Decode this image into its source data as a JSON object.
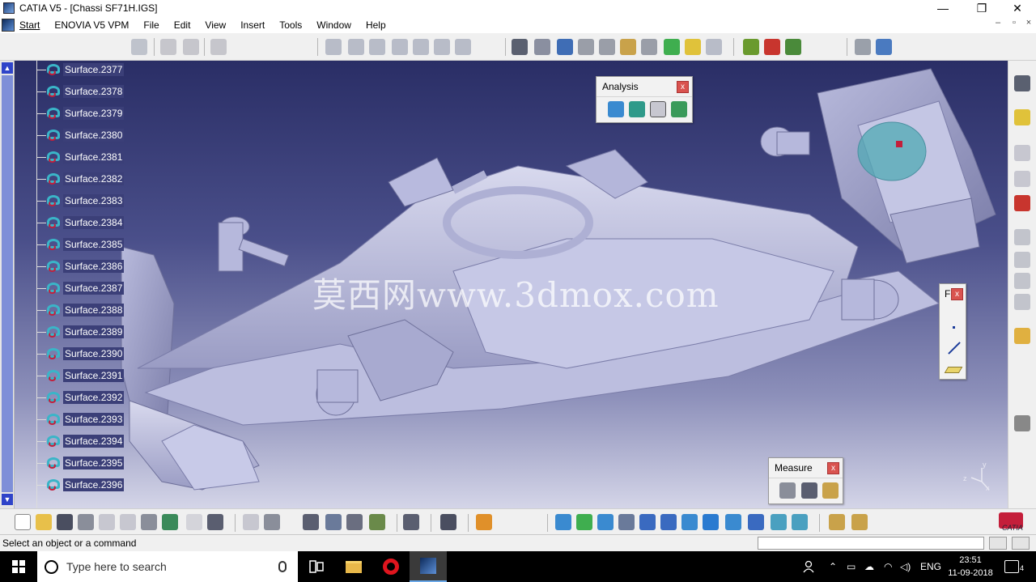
{
  "window": {
    "title": "CATIA V5 - [Chassi SF71H.IGS]",
    "minimize": "—",
    "maximize": "❐",
    "close": "✕"
  },
  "menu": {
    "items": [
      "Start",
      "ENOVIA V5 VPM",
      "File",
      "Edit",
      "View",
      "Insert",
      "Tools",
      "Window",
      "Help"
    ],
    "doc_controls": [
      "–",
      "▫",
      "×"
    ]
  },
  "tree": {
    "items": [
      "Surface.2377",
      "Surface.2378",
      "Surface.2379",
      "Surface.2380",
      "Surface.2381",
      "Surface.2382",
      "Surface.2383",
      "Surface.2384",
      "Surface.2385",
      "Surface.2386",
      "Surface.2387",
      "Surface.2388",
      "Surface.2389",
      "Surface.2390",
      "Surface.2391",
      "Surface.2392",
      "Surface.2393",
      "Surface.2394",
      "Surface.2395",
      "Surface.2396"
    ]
  },
  "viewport": {
    "watermark": "莫西网www.3dmox.com",
    "axis_labels": [
      "y",
      "z",
      "x"
    ]
  },
  "analysis_palette": {
    "title": "Analysis",
    "close": "x"
  },
  "measure_palette": {
    "title": "Measure",
    "close": "x"
  },
  "small_palette": {
    "title": "F",
    "close": "x"
  },
  "statusbar": {
    "message": "Select an object or a command"
  },
  "taskbar": {
    "search_placeholder": "Type here to search",
    "language": "ENG",
    "time": "23:51",
    "date": "11-09-2018",
    "notifications": "4"
  },
  "brand": {
    "logo_text": "CATIA"
  }
}
